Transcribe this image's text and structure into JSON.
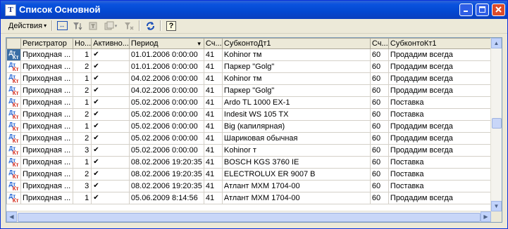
{
  "window": {
    "title": "Список Основной",
    "app_icon_glyph": "Т"
  },
  "toolbar": {
    "actions_label": "Действия",
    "icons": [
      "swap-columns-icon",
      "filter-icon",
      "filter-by-value-icon",
      "filter-history-icon",
      "clear-filter-icon",
      "refresh-icon",
      "help-icon"
    ],
    "help_glyph": "?"
  },
  "table": {
    "columns": [
      "",
      "Регистратор",
      "Но...",
      "Активно...",
      "Период",
      "Сч...",
      "СубконтоДт1",
      "Сч...",
      "СубконтоКт1"
    ],
    "sort_indicator": "▾",
    "rows": [
      {
        "registrar": "Приходная ...",
        "num": "1",
        "active": "✔",
        "period": "01.01.2006 0:00:00",
        "acc_dt": "41",
        "sub_dt": "Kohinor тм",
        "acc_kt": "60",
        "sub_kt": "Продадим всегда"
      },
      {
        "registrar": "Приходная ...",
        "num": "2",
        "active": "✔",
        "period": "01.01.2006 0:00:00",
        "acc_dt": "41",
        "sub_dt": "Паркер \"Golg\"",
        "acc_kt": "60",
        "sub_kt": "Продадим всегда"
      },
      {
        "registrar": "Приходная ...",
        "num": "1",
        "active": "✔",
        "period": "04.02.2006 0:00:00",
        "acc_dt": "41",
        "sub_dt": "Kohinor тм",
        "acc_kt": "60",
        "sub_kt": "Продадим всегда"
      },
      {
        "registrar": "Приходная ...",
        "num": "2",
        "active": "✔",
        "period": "04.02.2006 0:00:00",
        "acc_dt": "41",
        "sub_dt": "Паркер \"Golg\"",
        "acc_kt": "60",
        "sub_kt": "Продадим всегда"
      },
      {
        "registrar": "Приходная ...",
        "num": "1",
        "active": "✔",
        "period": "05.02.2006 0:00:00",
        "acc_dt": "41",
        "sub_dt": "Ardo TL 1000 EX-1",
        "acc_kt": "60",
        "sub_kt": "Поставка"
      },
      {
        "registrar": "Приходная ...",
        "num": "2",
        "active": "✔",
        "period": "05.02.2006 0:00:00",
        "acc_dt": "41",
        "sub_dt": "Indesit WS 105 TX",
        "acc_kt": "60",
        "sub_kt": "Поставка"
      },
      {
        "registrar": "Приходная ...",
        "num": "1",
        "active": "✔",
        "period": "05.02.2006 0:00:00",
        "acc_dt": "41",
        "sub_dt": "Big (капилярная)",
        "acc_kt": "60",
        "sub_kt": "Продадим всегда"
      },
      {
        "registrar": "Приходная ...",
        "num": "2",
        "active": "✔",
        "period": "05.02.2006 0:00:00",
        "acc_dt": "41",
        "sub_dt": "Шариковая обычная",
        "acc_kt": "60",
        "sub_kt": "Продадим всегда"
      },
      {
        "registrar": "Приходная ...",
        "num": "3",
        "active": "✔",
        "period": "05.02.2006 0:00:00",
        "acc_dt": "41",
        "sub_dt": "Kohinor т",
        "acc_kt": "60",
        "sub_kt": "Продадим всегда"
      },
      {
        "registrar": "Приходная ...",
        "num": "1",
        "active": "✔",
        "period": "08.02.2006 19:20:35",
        "acc_dt": "41",
        "sub_dt": "BOSCH KGS 3760 IE",
        "acc_kt": "60",
        "sub_kt": "Поставка"
      },
      {
        "registrar": "Приходная ...",
        "num": "2",
        "active": "✔",
        "period": "08.02.2006 19:20:35",
        "acc_dt": "41",
        "sub_dt": "ELECTROLUX ER 9007 B",
        "acc_kt": "60",
        "sub_kt": "Поставка"
      },
      {
        "registrar": "Приходная ...",
        "num": "3",
        "active": "✔",
        "period": "08.02.2006 19:20:35",
        "acc_dt": "41",
        "sub_dt": "Атлант МХМ 1704-00",
        "acc_kt": "60",
        "sub_kt": "Поставка"
      },
      {
        "registrar": "Приходная ...",
        "num": "1",
        "active": "✔",
        "period": "05.06.2009 8:14:56",
        "acc_dt": "41",
        "sub_dt": "Атлант МХМ 1704-00",
        "acc_kt": "60",
        "sub_kt": "Продадим всегда"
      }
    ],
    "row_icon": {
      "dt": "Дт",
      "kt": "Кт"
    }
  },
  "colors": {
    "titlebar": "#0a52de",
    "selection": "#3a6ea5",
    "dt": "#1a5fd3",
    "kt": "#d32a1a"
  }
}
